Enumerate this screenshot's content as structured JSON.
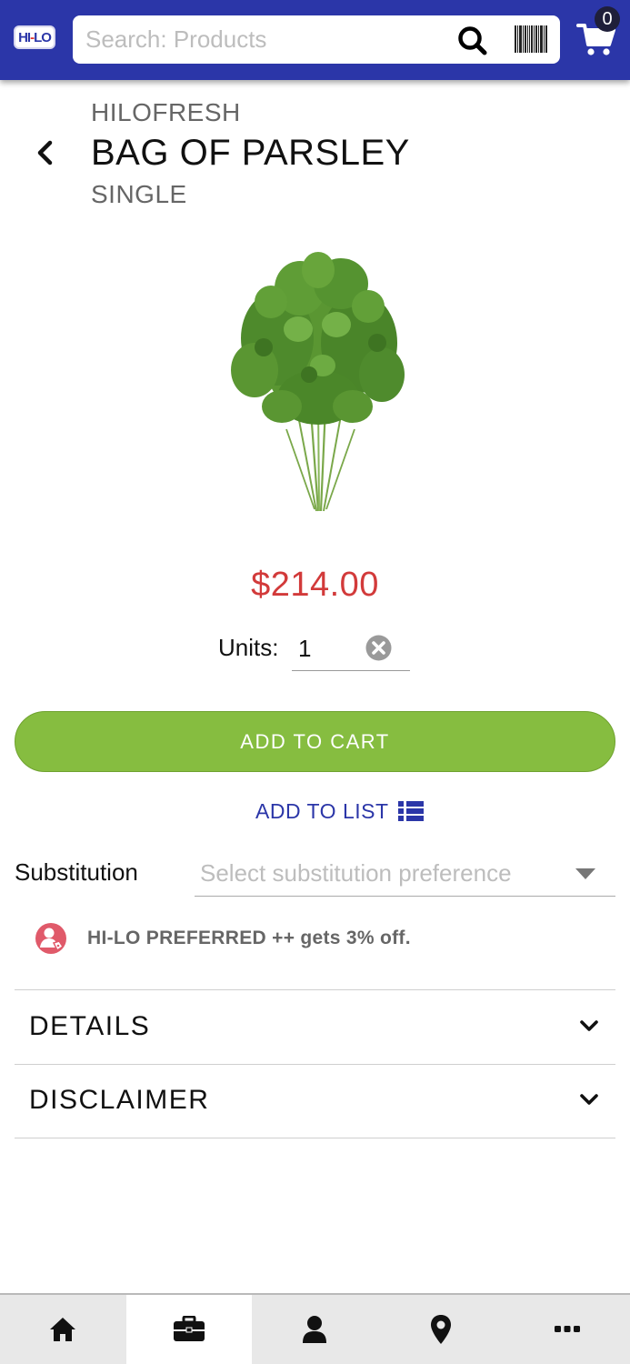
{
  "header": {
    "logo_text_left": "HI",
    "logo_text_mid": "-",
    "logo_text_right": "LO",
    "search_placeholder": "Search: Products",
    "cart_count": "0",
    "icons": [
      "logo",
      "search-icon",
      "barcode-icon",
      "cart-icon"
    ],
    "bar_color": "#2b36a8"
  },
  "product": {
    "brand": "HILOFRESH",
    "name": "BAG OF PARSLEY",
    "size": "SINGLE",
    "price": "$214.00",
    "price_color": "#d23a3a",
    "image_icon": "parsley-bunch"
  },
  "units": {
    "label": "Units:",
    "value": "1"
  },
  "actions": {
    "add_to_cart": "ADD TO CART",
    "add_to_cart_color": "#86bd40",
    "add_to_list": "ADD TO LIST"
  },
  "substitution": {
    "label": "Substitution",
    "placeholder": "Select substitution preference"
  },
  "promo": {
    "text": "HI-LO PREFERRED ++ gets 3% off.",
    "icon": "user-tag-icon",
    "icon_color": "#e05a6a"
  },
  "sections": [
    {
      "label": "DETAILS"
    },
    {
      "label": "DISCLAIMER"
    }
  ],
  "bottom_nav": {
    "items": [
      "home-icon",
      "briefcase-icon",
      "user-icon",
      "location-pin-icon",
      "more-icon"
    ],
    "active_index": 1
  }
}
